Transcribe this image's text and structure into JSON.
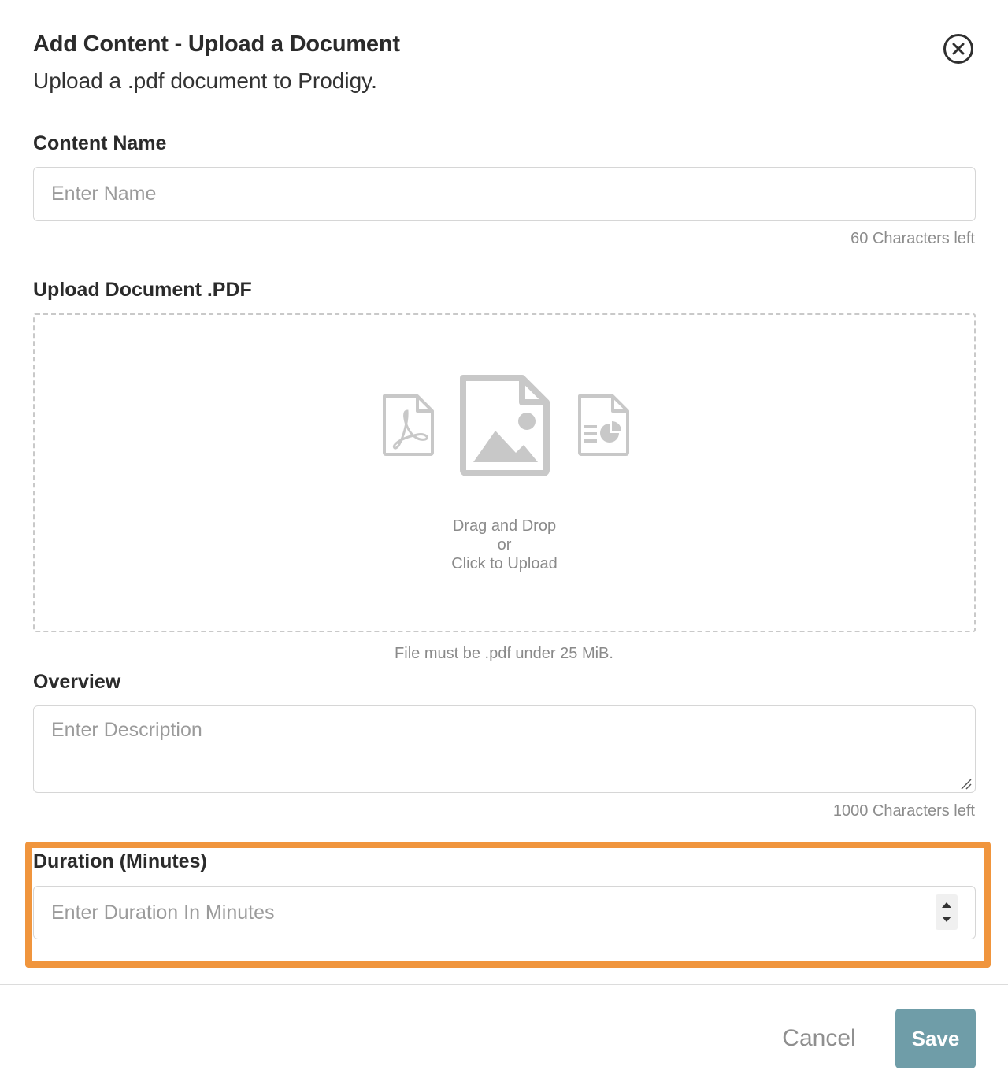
{
  "header": {
    "title": "Add Content - Upload a Document",
    "subtitle": "Upload a .pdf document to Prodigy."
  },
  "content_name": {
    "label": "Content Name",
    "placeholder": "Enter Name",
    "value": "",
    "counter": "60 Characters left"
  },
  "upload": {
    "label": "Upload Document .PDF",
    "line1": "Drag and Drop",
    "line2": "or",
    "line3": "Click to Upload",
    "hint": "File must be .pdf under 25 MiB.",
    "icons": [
      "pdf-file-icon",
      "image-file-icon",
      "chart-document-icon"
    ]
  },
  "overview": {
    "label": "Overview",
    "placeholder": "Enter Description",
    "value": "",
    "counter": "1000 Characters left"
  },
  "duration": {
    "label": "Duration (Minutes)",
    "placeholder": "Enter Duration In Minutes",
    "value": ""
  },
  "footer": {
    "cancel_label": "Cancel",
    "save_label": "Save"
  },
  "colors": {
    "highlight": "#f0953d",
    "save_button": "#6f9da8",
    "icon_gray": "#c8c8c8"
  }
}
